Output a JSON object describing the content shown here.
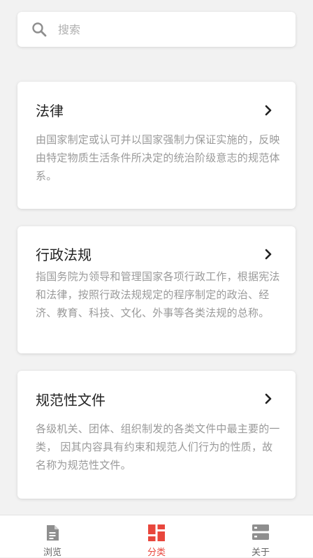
{
  "search": {
    "placeholder": "搜索",
    "icon": "search-icon"
  },
  "categories": [
    {
      "title": "法律",
      "description": "由国家制定或认可并以国家强制力保证实施的，反映由特定物质生活条件所决定的统治阶级意志的规范体系。",
      "icon": "chevron-right-icon"
    },
    {
      "title": "行政法规",
      "description": "指国务院为领导和管理国家各项行政工作，根据宪法和法律，按照行政法规规定的程序制定的政治、经济、教育、科技、文化、外事等各类法规的总称。",
      "icon": "chevron-right-icon"
    },
    {
      "title": "规范性文件",
      "description": "各级机关、团体、组织制发的各类文件中最主要的一类， 因其内容具有约束和规范人们行为的性质，故名称为规范性文件。",
      "icon": "chevron-right-icon"
    }
  ],
  "tabbar": {
    "tabs": [
      {
        "label": "浏览",
        "icon": "document-icon",
        "active": false
      },
      {
        "label": "分类",
        "icon": "grid-icon",
        "active": true
      },
      {
        "label": "关于",
        "icon": "server-icon",
        "active": false
      }
    ]
  },
  "colors": {
    "accent": "#e8463c",
    "icon_inactive": "#8e8e8e",
    "background": "#f2f2f2"
  }
}
